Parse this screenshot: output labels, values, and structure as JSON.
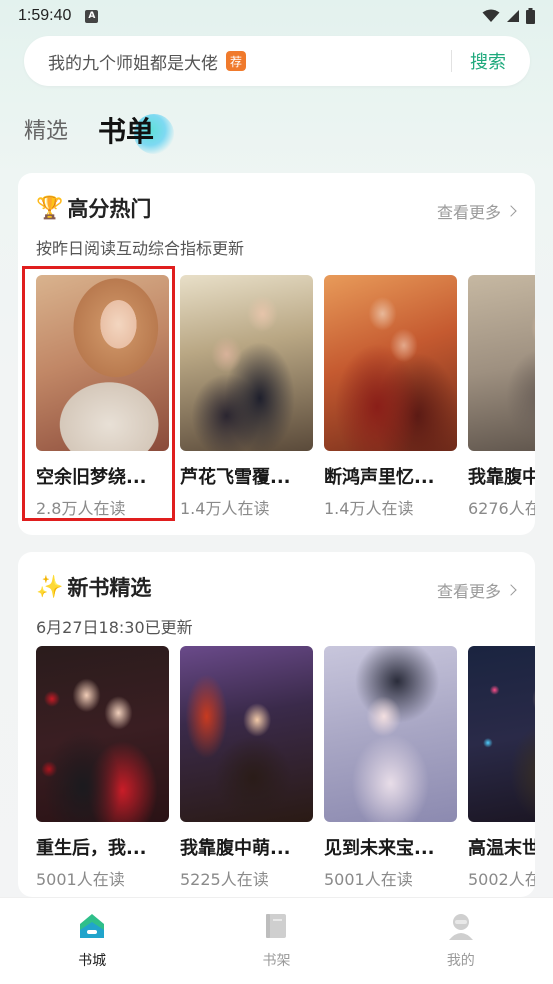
{
  "status_bar": {
    "time": "1:59:40",
    "a_badge": "A"
  },
  "search": {
    "query": "我的九个师姐都是大佬",
    "rec_badge": "荐",
    "button_label": "搜索"
  },
  "tabs": [
    {
      "label": "精选",
      "active": false
    },
    {
      "label": "书单",
      "active": true
    }
  ],
  "sections": [
    {
      "emoji": "🏆",
      "title": "高分热门",
      "see_more": "查看更多",
      "subtitle": "按昨日阅读互动综合指标更新",
      "books": [
        {
          "title": "空余旧梦绕...",
          "readers": "2.8万人在读"
        },
        {
          "title": "芦花飞雪覆...",
          "readers": "1.4万人在读"
        },
        {
          "title": "断鸿声里忆...",
          "readers": "1.4万人在读"
        },
        {
          "title": "我靠腹中",
          "readers": "6276人在"
        }
      ]
    },
    {
      "emoji": "✨",
      "title": "新书精选",
      "see_more": "查看更多",
      "subtitle": "6月27日18:30已更新",
      "books": [
        {
          "title": "重生后，我...",
          "readers": "5001人在读"
        },
        {
          "title": "我靠腹中萌...",
          "readers": "5225人在读"
        },
        {
          "title": "见到未来宝...",
          "readers": "5001人在读"
        },
        {
          "title": "高温末世",
          "readers": "5002人在"
        }
      ]
    }
  ],
  "bottom_nav": [
    {
      "label": "书城",
      "icon": "bookstore-icon",
      "active": true
    },
    {
      "label": "书架",
      "icon": "bookshelf-icon",
      "active": false
    },
    {
      "label": "我的",
      "icon": "profile-icon",
      "active": false
    }
  ],
  "colors": {
    "accent": "#1ea97c",
    "highlight": "#e01e1e",
    "badge": "#f07a2c"
  }
}
